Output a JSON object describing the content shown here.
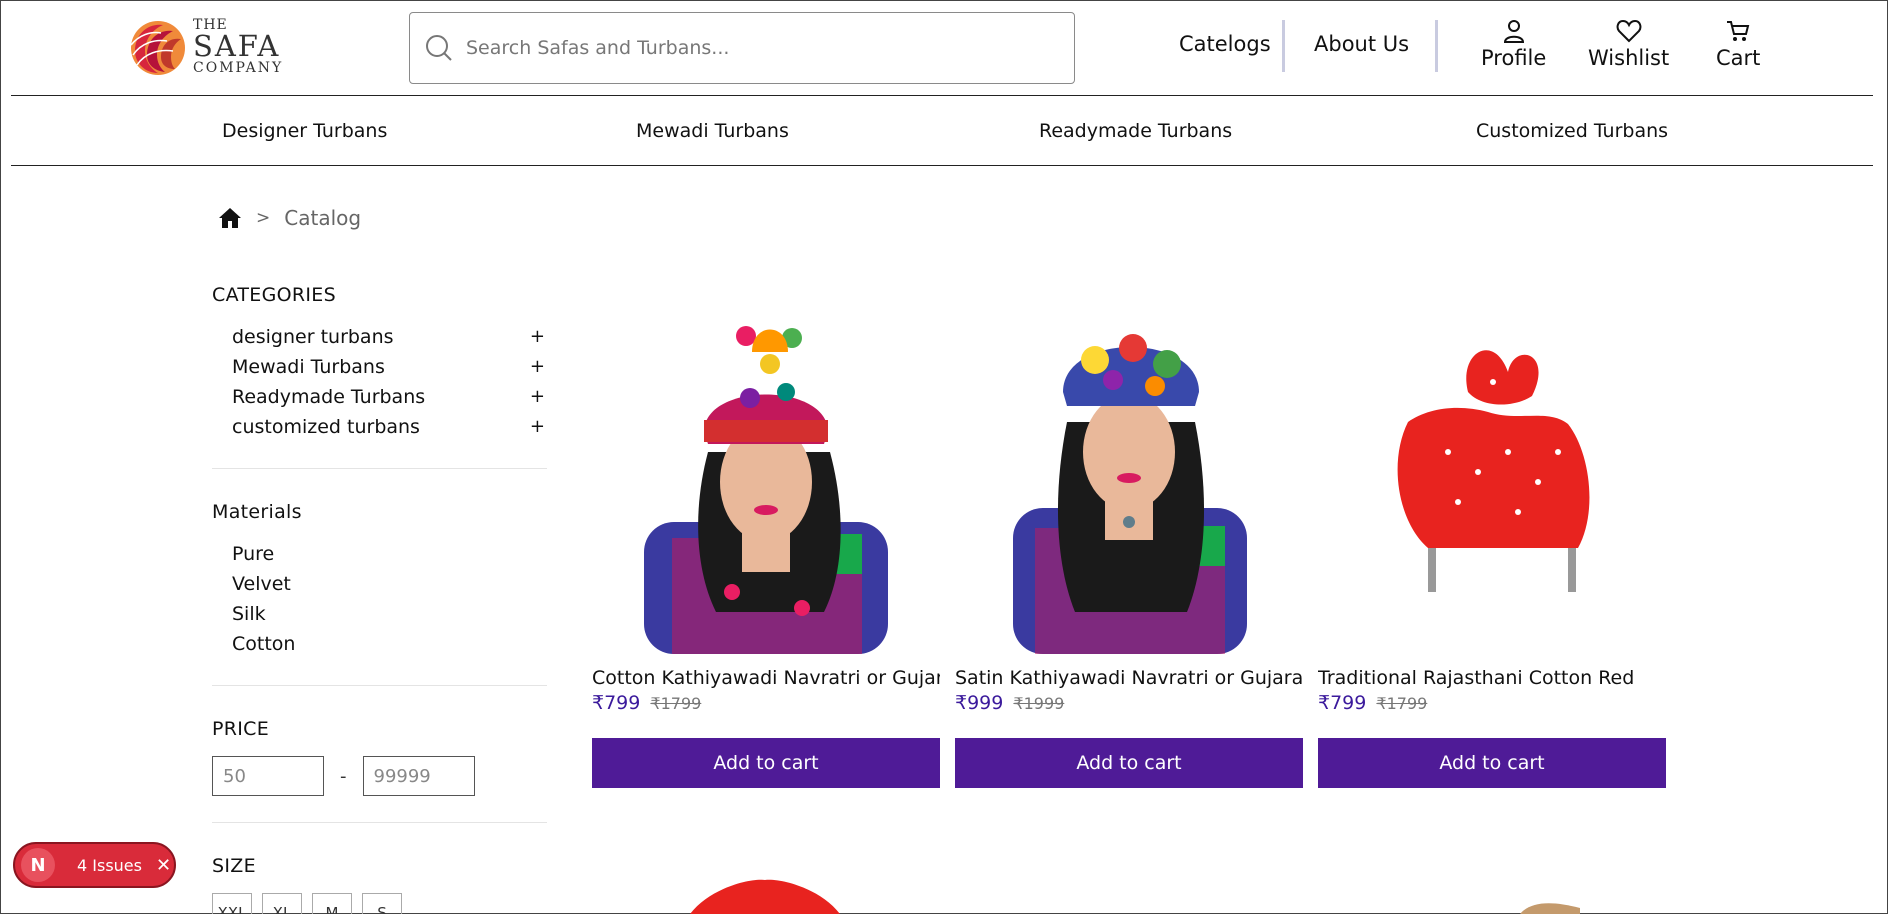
{
  "header": {
    "logo": {
      "the": "THE",
      "name": "SAFA",
      "company": "COMPANY"
    },
    "search_placeholder": "Search Safas and Turbans...",
    "nav": {
      "catalogs": "Catelogs",
      "about": "About Us"
    },
    "profile": "Profile",
    "wishlist": "Wishlist",
    "cart": "Cart"
  },
  "category_bar": [
    "Designer Turbans",
    "Mewadi Turbans",
    "Readymade Turbans",
    "Customized Turbans"
  ],
  "breadcrumb": {
    "separator": ">",
    "current": "Catalog"
  },
  "sidebar": {
    "categories_title": "CATEGORIES",
    "categories": [
      "designer turbans",
      "Mewadi Turbans",
      "Readymade Turbans",
      "customized turbans"
    ],
    "expand_symbol": "+",
    "materials_title": "Materials",
    "materials": [
      "Pure",
      "Velvet",
      "Silk",
      "Cotton"
    ],
    "price_title": "PRICE",
    "price_min": "50",
    "price_max": "99999",
    "price_dash": "-",
    "size_title": "SIZE",
    "sizes": [
      "XXL",
      "XL",
      "M",
      "S"
    ]
  },
  "products": [
    {
      "name": "Cotton Kathiyawadi Navratri or Gujarati",
      "price": "₹799",
      "old_price": "₹1799",
      "button": "Add to cart"
    },
    {
      "name": "Satin Kathiyawadi Navratri or Gujarati",
      "price": "₹999",
      "old_price": "₹1999",
      "button": "Add to cart"
    },
    {
      "name": "Traditional Rajasthani Cotton Red",
      "price": "₹799",
      "old_price": "₹1799",
      "button": "Add to cart"
    }
  ],
  "issues_badge": {
    "letter": "N",
    "label": "4 Issues",
    "close": "✕"
  },
  "colors": {
    "accent": "#4f1b97",
    "price": "#3b1a9c",
    "issues": "#d92b3a"
  }
}
